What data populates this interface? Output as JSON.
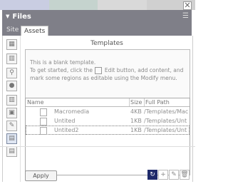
{
  "window": {
    "title": "Files",
    "close_glyph": "✕",
    "menu_glyph": "☰"
  },
  "tabs": [
    {
      "label": "Site",
      "active": false
    },
    {
      "label": "Assets",
      "active": true
    }
  ],
  "categories": [
    {
      "icon": "images-icon",
      "glyph": "▦"
    },
    {
      "icon": "colors-icon",
      "glyph": "▥"
    },
    {
      "icon": "urls-icon",
      "glyph": "⚲"
    },
    {
      "icon": "flash-icon",
      "glyph": "●"
    },
    {
      "icon": "shockwave-icon",
      "glyph": "▥"
    },
    {
      "icon": "movies-icon",
      "glyph": "▣"
    },
    {
      "icon": "scripts-icon",
      "glyph": "✎"
    },
    {
      "icon": "templates-icon",
      "glyph": "▤",
      "active": true
    },
    {
      "icon": "library-icon",
      "glyph": "▤"
    }
  ],
  "pane": {
    "title": "Templates"
  },
  "preview": {
    "line1": "This is a blank template.",
    "line2a": "To get started, click the",
    "line2b": "Edit button, add content, and",
    "line3": "mark some regions as editable using the Modify menu."
  },
  "table": {
    "columns": [
      "Name",
      "Size",
      "Full Path"
    ],
    "rows": [
      {
        "name": "Macromedia",
        "size": "4KB",
        "path": "/Templates/Mac"
      },
      {
        "name": "Untited",
        "size": "1KB",
        "path": "/Templates/Unt"
      },
      {
        "name": "Untited2",
        "size": "1KB",
        "path": "/Templates/Unt",
        "selected": true
      }
    ]
  },
  "footer": {
    "apply_label": "Apply",
    "refresh_glyph": "↻",
    "new_glyph": "+",
    "edit_glyph": "✎",
    "delete_glyph": "🗑"
  },
  "colors": {
    "titlebar": "#7f7f88",
    "accent": "#1f2a6a"
  }
}
